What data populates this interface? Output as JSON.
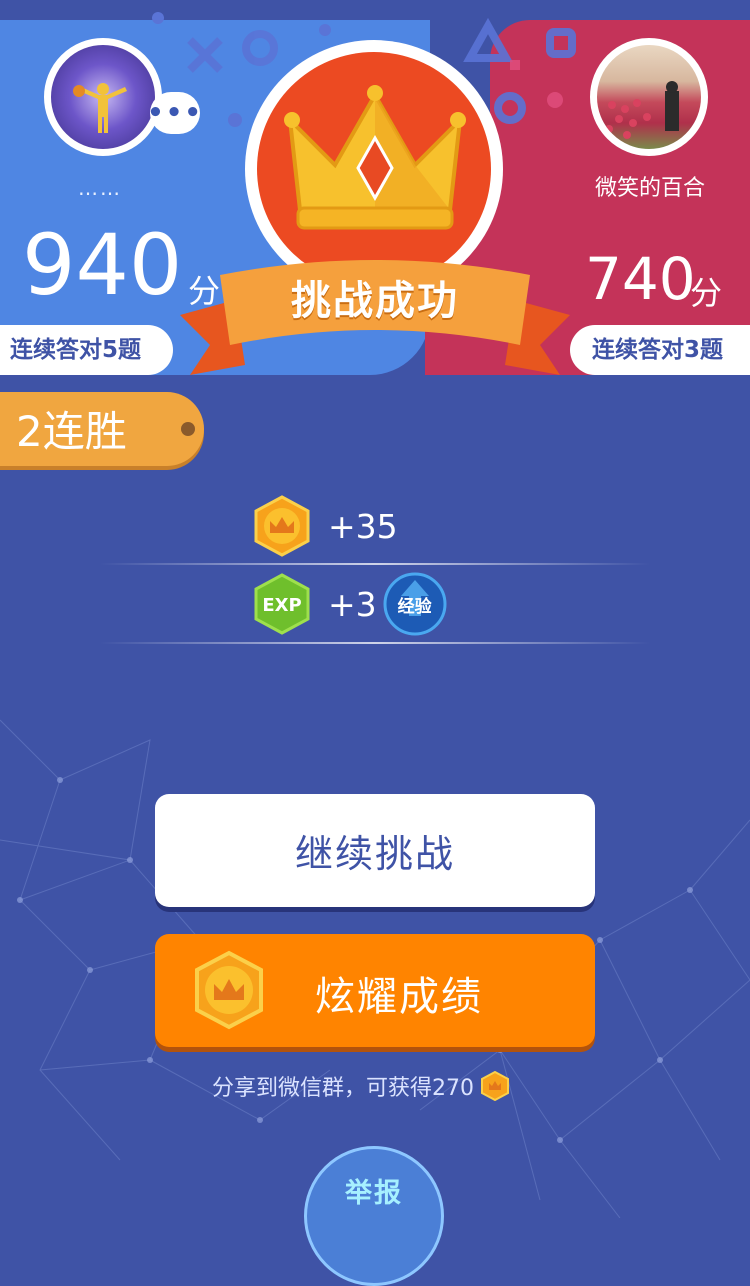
{
  "colors": {
    "background": "#3f53a6",
    "left_panel": "#4f86e3",
    "right_panel": "#c43359",
    "badge_red": "#ec4a22",
    "ribbon_orange": "#f5a03d",
    "win_tag": "#f0a640",
    "primary_button": "#ff8400"
  },
  "player_left": {
    "name": "……",
    "score": "940",
    "score_unit": "分",
    "streak_label": "连续答对5题",
    "chat_icon": "more-dots-icon"
  },
  "player_right": {
    "name": "微笑的百合",
    "score": "740",
    "score_unit": "分",
    "streak_label": "连续答对3题"
  },
  "result": {
    "ribbon_text": "挑战成功",
    "badge_icon": "crown-icon"
  },
  "win_streak": {
    "label": "2连胜"
  },
  "rewards": {
    "coins": {
      "icon": "crown-coin-icon",
      "amount": "+35"
    },
    "exp": {
      "icon": "exp-gem-icon",
      "amount": "+3",
      "badge_label": "经验"
    }
  },
  "actions": {
    "continue_label": "继续挑战",
    "show_off_label": "炫耀成绩",
    "share_tip": "分享到微信群，可获得270",
    "report_label": "举报"
  }
}
